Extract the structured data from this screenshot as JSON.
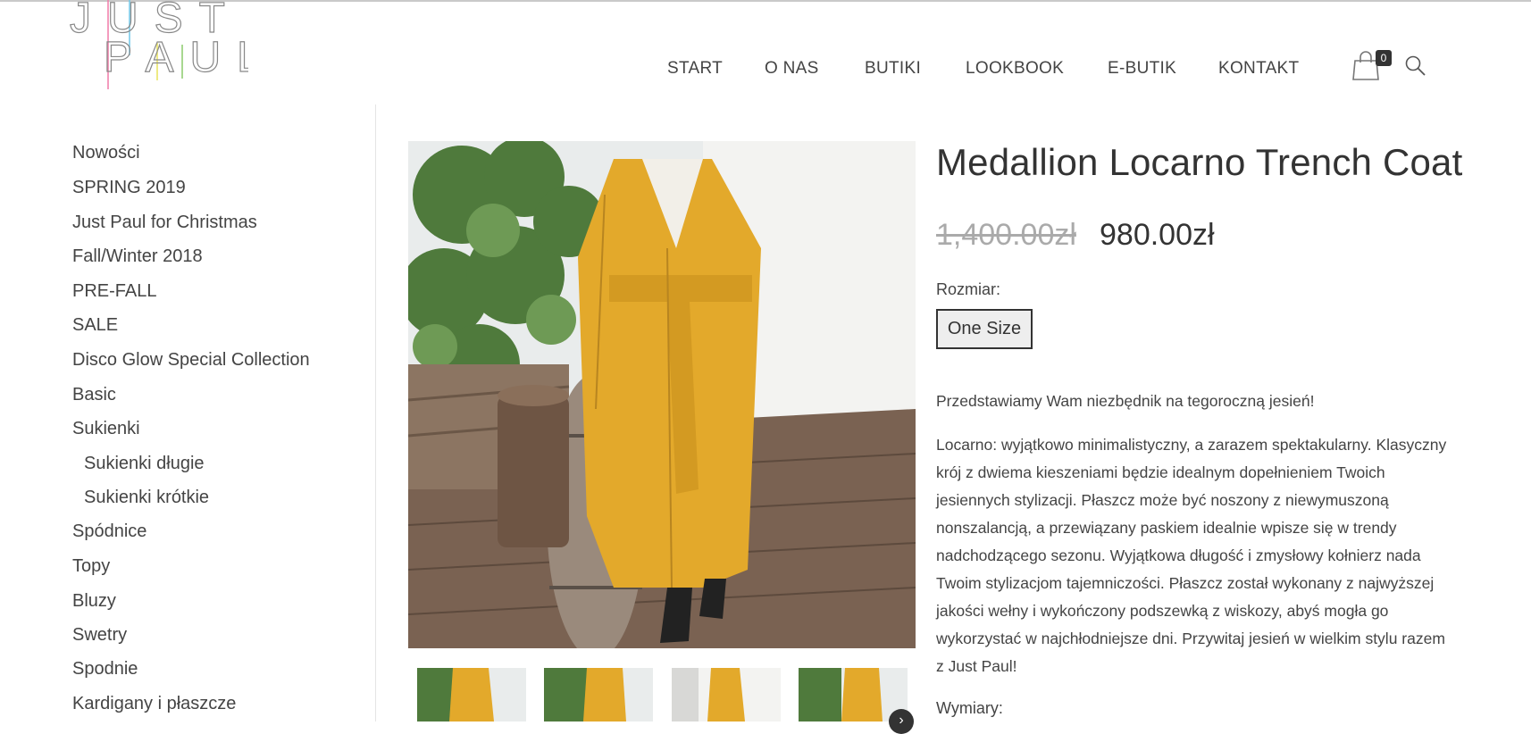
{
  "brand": {
    "line1": "JUST",
    "line2": "PAUL"
  },
  "nav": {
    "items": [
      {
        "label": "START"
      },
      {
        "label": "O NAS"
      },
      {
        "label": "BUTIKI"
      },
      {
        "label": "LOOKBOOK"
      },
      {
        "label": "E-BUTIK"
      },
      {
        "label": "KONTAKT"
      }
    ],
    "cart_count": "0",
    "cart_icon": "shopping-bag-icon",
    "search_icon": "search-icon"
  },
  "sidebar": {
    "categories": [
      {
        "label": "Nowości"
      },
      {
        "label": "SPRING 2019"
      },
      {
        "label": "Just Paul for Christmas"
      },
      {
        "label": "Fall/Winter 2018"
      },
      {
        "label": "PRE-FALL"
      },
      {
        "label": "SALE"
      },
      {
        "label": "Disco Glow Special Collection"
      },
      {
        "label": "Basic"
      },
      {
        "label": "Sukienki"
      },
      {
        "label": "Sukienki długie"
      },
      {
        "label": "Sukienki krótkie"
      },
      {
        "label": "Spódnice"
      },
      {
        "label": "Topy"
      },
      {
        "label": "Bluzy"
      },
      {
        "label": "Swetry"
      },
      {
        "label": "Spodnie"
      },
      {
        "label": "Kardigany i płaszcze"
      }
    ]
  },
  "product": {
    "title": "Medallion Locarno Trench Coat",
    "price_old": "1,400.00zł",
    "price_new": "980.00zł",
    "size_label": "Rozmiar:",
    "size_option": "One Size",
    "description": [
      "Przedstawiamy Wam niezbędnik na tegoroczną jesień!",
      "Locarno: wyjątkowo minimalistyczny, a zarazem spektakularny. Klasyczny krój z dwiema kieszeniami będzie idealnym dopełnieniem Twoich jesiennych stylizacji. Płaszcz może być noszony z niewymuszoną nonszalancją, a przewiązany paskiem idealnie wpisze się w trendy nadchodzącego sezonu. Wyjątkowa długość i zmysłowy kołnierz nada Twoim stylizacjom tajemniczości. Płaszcz został wykonany z najwyższej jakości wełny i wykończony podszewką z wiskozy, abyś mogła go wykorzystać w najchłodniejsze dni. Przywitaj jesień w wielkim stylu razem z Just Paul!"
    ],
    "dims_label": "Wymiary:"
  },
  "colors": {
    "coat": "#E3A92B",
    "text": "#333333",
    "old_price": "#AAAAAA"
  }
}
